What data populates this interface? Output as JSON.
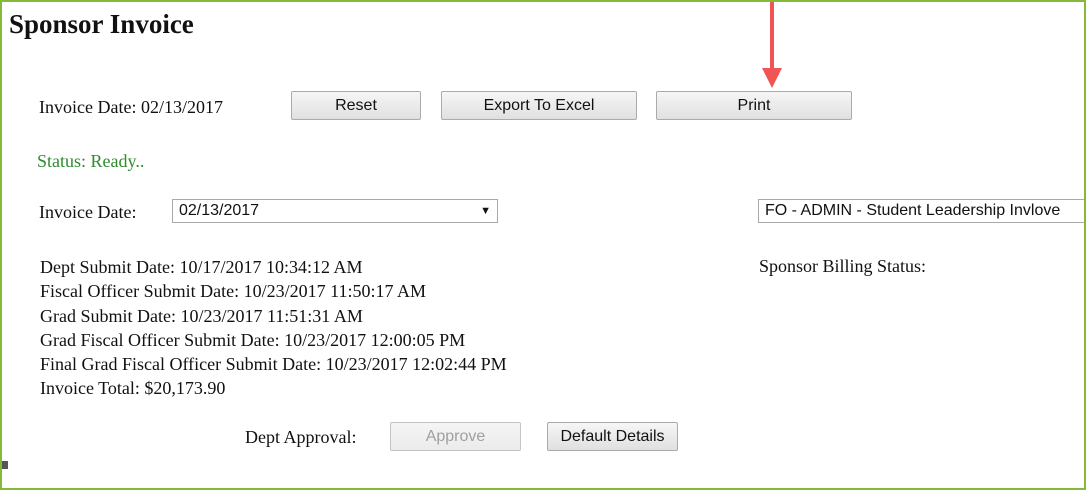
{
  "page": {
    "title": "Sponsor Invoice"
  },
  "toolbar": {
    "invoice_date_label": "Invoice Date: 02/13/2017",
    "reset_label": "Reset",
    "export_label": "Export To Excel",
    "print_label": "Print"
  },
  "status": {
    "text": "Status: Ready.."
  },
  "filters": {
    "invoice_date_label": "Invoice Date:",
    "invoice_date_value": "02/13/2017",
    "sponsor_select_value": "FO - ADMIN - Student Leadership Invlove",
    "sponsor_billing_status_label": "Sponsor Billing Status:"
  },
  "details": {
    "lines": [
      "Dept Submit Date: 10/17/2017 10:34:12 AM",
      "Fiscal Officer Submit Date: 10/23/2017 11:50:17 AM",
      "Grad Submit Date: 10/23/2017 11:51:31 AM",
      "Grad Fiscal Officer Submit Date: 10/23/2017 12:00:05 PM",
      "Final Grad Fiscal Officer Submit Date: 10/23/2017 12:02:44 PM",
      "Invoice Total: $20,173.90"
    ]
  },
  "approval": {
    "label": "Dept Approval:",
    "approve_label": "Approve",
    "approve_enabled": false,
    "default_details_label": "Default Details"
  },
  "annotation": {
    "arrow_color": "#f05454",
    "arrow_target": "print-button"
  },
  "colors": {
    "frame_border": "#86b83a",
    "status_text": "#2e8b2e"
  },
  "icons": {
    "select_arrow": "chevron-down-icon",
    "annotation_arrow": "red-arrow-down-icon"
  }
}
